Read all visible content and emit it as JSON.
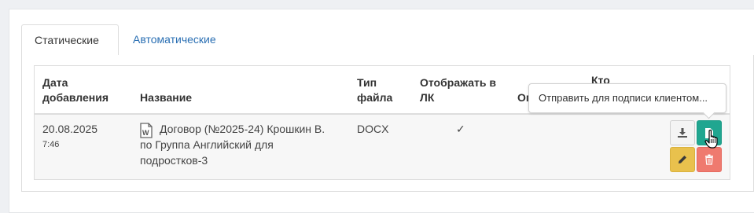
{
  "tabs": [
    {
      "label": "Статические",
      "active": true
    },
    {
      "label": "Автоматические",
      "active": false
    }
  ],
  "table": {
    "headers": {
      "date_line1": "Дата",
      "date_line2": "добавления",
      "name": "Название",
      "type_line1": "Тип",
      "type_line2": "файла",
      "show_line1": "Отображать в",
      "show_line2": "ЛК",
      "who_partial": "Кто",
      "col5_partial": "Оп"
    },
    "rows": [
      {
        "date": "20.08.2025",
        "time": "7:46",
        "name_line1": "Договор (№2025-24) Крошкин В.",
        "name_line2": "по Группа Английский для",
        "name_line3": "подростков-3",
        "type": "DOCX",
        "show_in_lk": "✓",
        "file_icon": "word-file-icon"
      }
    ]
  },
  "tooltip": {
    "text": "Отправить для подписи клиентом..."
  },
  "actions": {
    "download_icon": "download-icon",
    "sign_icon": "document-icon",
    "edit_icon": "pencil-icon",
    "delete_icon": "trash-icon"
  },
  "colors": {
    "tab_link": "#2a6fb3",
    "sign_button": "#20a690",
    "edit_button": "#e9c14d",
    "delete_button": "#ef7a6f"
  }
}
